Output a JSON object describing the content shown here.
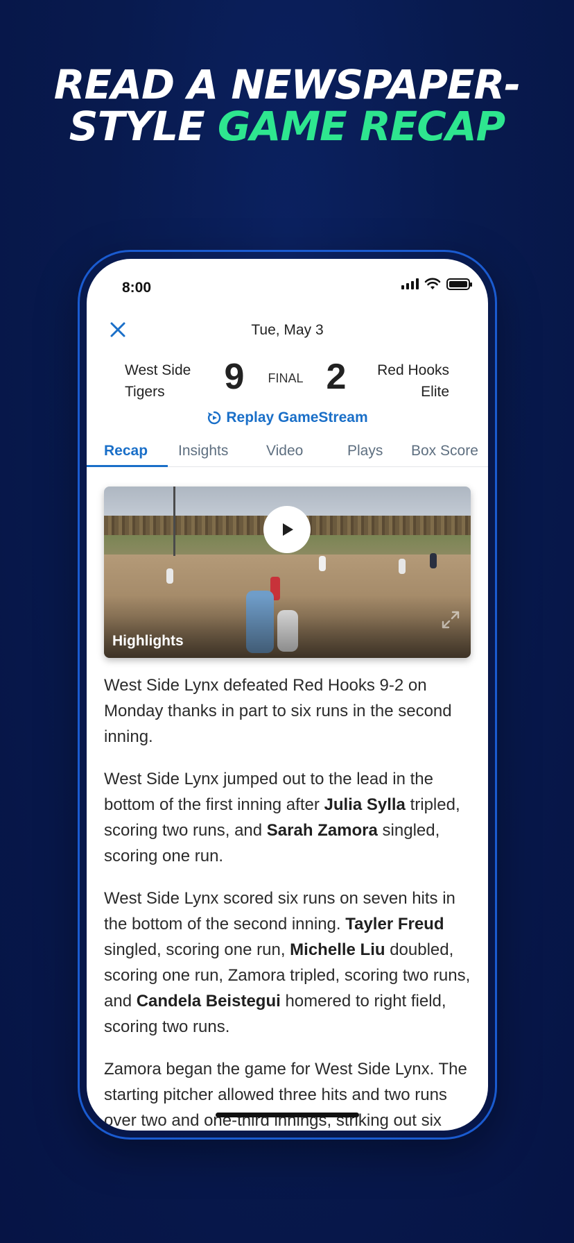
{
  "headline": {
    "line1": "READ A NEWSPAPER-",
    "line2_white": "STYLE",
    "line2_accent": "GAME RECAP",
    "accent_color": "#2ee68f"
  },
  "status_bar": {
    "time": "8:00",
    "icons": [
      "cellular-signal-icon",
      "wifi-icon",
      "battery-icon"
    ]
  },
  "header": {
    "close_icon": "close-icon",
    "date": "Tue, May 3"
  },
  "scoreboard": {
    "home_team_line1": "West Side",
    "home_team_line2": "Tigers",
    "home_score": "9",
    "status": "FINAL",
    "away_score": "2",
    "away_team_line1": "Red Hooks",
    "away_team_line2": "Elite",
    "replay_label": "Replay GameStream",
    "replay_icon": "replay-icon"
  },
  "tabs": [
    {
      "label": "Recap",
      "active": true
    },
    {
      "label": "Insights",
      "active": false
    },
    {
      "label": "Video",
      "active": false
    },
    {
      "label": "Plays",
      "active": false
    },
    {
      "label": "Box Score",
      "active": false
    }
  ],
  "video": {
    "label": "Highlights",
    "play_icon": "play-icon",
    "expand_icon": "expand-icon"
  },
  "article": {
    "p1": "West Side Lynx defeated Red Hooks 9-2 on Monday thanks in part to six runs in the second inning.",
    "p2_a": "West Side Lynx jumped out to the lead in the bottom of the first inning after ",
    "p2_b": "Julia Sylla",
    "p2_c": " tripled, scoring two runs, and ",
    "p2_d": "Sarah Zamora",
    "p2_e": " singled, scoring one run.",
    "p3_a": "West Side Lynx scored six runs on seven hits in the bottom of the second inning. ",
    "p3_b": "Tayler Freud",
    "p3_c": " singled, scoring one run, ",
    "p3_d": "Michelle Liu",
    "p3_e": " doubled, scoring one run, Zamora tripled, scoring two runs, and ",
    "p3_f": "Candela Beistegui",
    "p3_g": " homered to right field, scoring two runs.",
    "p4": "Zamora began the game for West Side Lynx. The starting pitcher allowed three hits and two runs over two and one-third innings, striking out six"
  },
  "colors": {
    "background": "#081a4e",
    "phone_border": "#1a5bd0",
    "link_blue": "#1a6fc8"
  }
}
